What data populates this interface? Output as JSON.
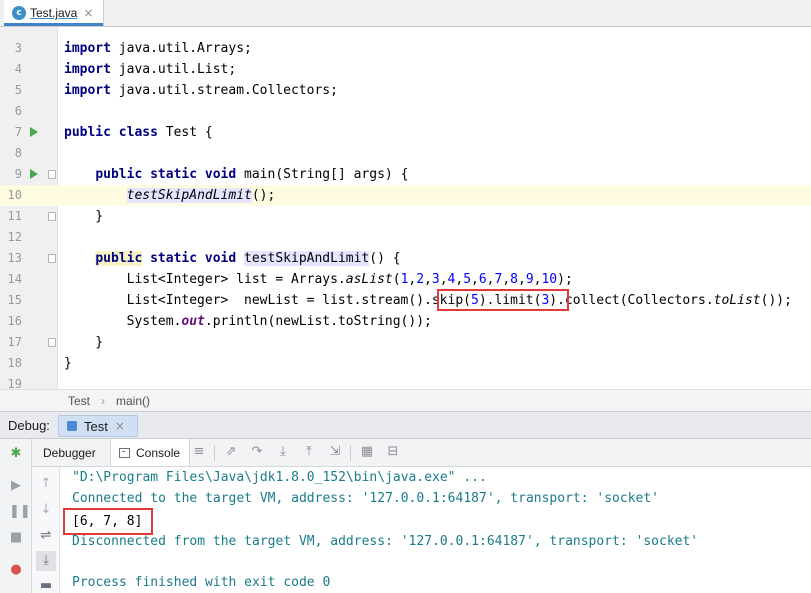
{
  "editor_tab": {
    "icon": "c",
    "title": "Test.java",
    "close": "×"
  },
  "editor": {
    "lines": [
      {
        "n": "3",
        "code": "import java.util.Arrays;"
      },
      {
        "n": "4",
        "code": "import java.util.List;"
      },
      {
        "n": "5",
        "code": "import java.util.stream.Collectors;"
      },
      {
        "n": "6",
        "code": ""
      },
      {
        "n": "7",
        "code": "public class Test {"
      },
      {
        "n": "8",
        "code": ""
      },
      {
        "n": "9",
        "code": "    public static void main(String[] args) {"
      },
      {
        "n": "10",
        "code": "        testSkipAndLimit();"
      },
      {
        "n": "11",
        "code": "    }"
      },
      {
        "n": "12",
        "code": ""
      },
      {
        "n": "13",
        "code": "    public static void testSkipAndLimit() {"
      },
      {
        "n": "14",
        "code": "        List<Integer> list = Arrays.asList(1,2,3,4,5,6,7,8,9,10);"
      },
      {
        "n": "15",
        "code": "        List<Integer>  newList = list.stream().skip(5).limit(3).collect(Collectors.toList());"
      },
      {
        "n": "16",
        "code": "        System.out.println(newList.toString());"
      },
      {
        "n": "17",
        "code": "    }"
      },
      {
        "n": "18",
        "code": "}"
      },
      {
        "n": "19",
        "code": ""
      }
    ],
    "current_line": "10"
  },
  "breadcrumb": {
    "class": "Test",
    "method": "main()"
  },
  "debug": {
    "label": "Debug:",
    "session": "Test",
    "session_close": "×",
    "tabs": {
      "debugger": "Debugger",
      "console": "Console"
    }
  },
  "console": {
    "lines": [
      {
        "text": "\"D:\\Program Files\\Java\\jdk1.8.0_152\\bin\\java.exe\" ...",
        "kind": "system"
      },
      {
        "text": "Connected to the target VM, address: '127.0.0.1:64187', transport: 'socket'",
        "kind": "system"
      },
      {
        "text": "[6, 7, 8]",
        "kind": "output"
      },
      {
        "text": "Disconnected from the target VM, address: '127.0.0.1:64187', transport: 'socket'",
        "kind": "system"
      },
      {
        "text": "",
        "kind": "output"
      },
      {
        "text": "Process finished with exit code 0",
        "kind": "system"
      }
    ]
  },
  "colors": {
    "keyword": "#000080",
    "number": "#0000ff",
    "console_system": "#1a7c8a",
    "highlight_box": "#e03a3a",
    "current_line": "#fffbe0"
  }
}
